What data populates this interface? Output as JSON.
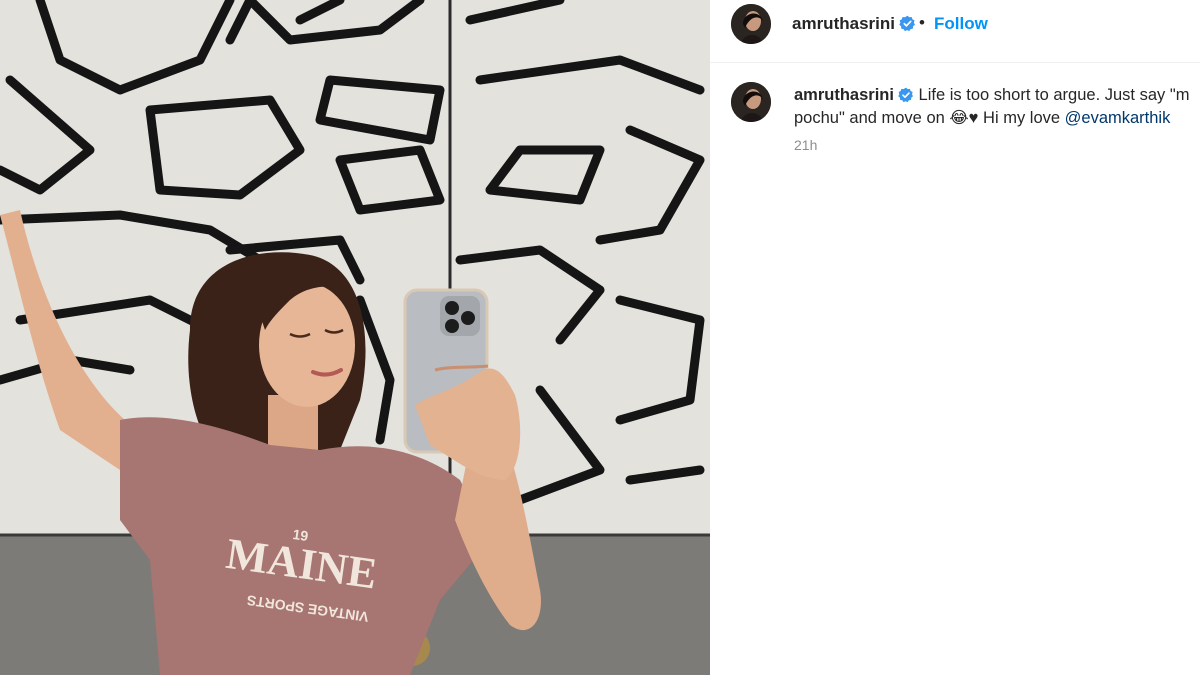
{
  "post": {
    "author": {
      "username": "amruthasrini",
      "verified": true,
      "follow_label": "Follow",
      "separator": "•"
    },
    "caption": {
      "line1": "Life is too short to argue. Just say \"m",
      "line2_prefix": "pochu\" and move on 😂♥ Hi my love ",
      "mention": "@evamkarthik"
    },
    "timestamp": "21h",
    "photo": {
      "shirt_print_top": "MAINE",
      "shirt_print_badge": "19",
      "shirt_print_bottom": "VINTAGE SPORTS"
    }
  },
  "colors": {
    "accent": "#0095f6",
    "verified_badge": "#3897f0",
    "mention": "#00376b",
    "text": "#262626",
    "muted": "#8e8e8e"
  },
  "icons": [
    "verified-badge-icon"
  ]
}
